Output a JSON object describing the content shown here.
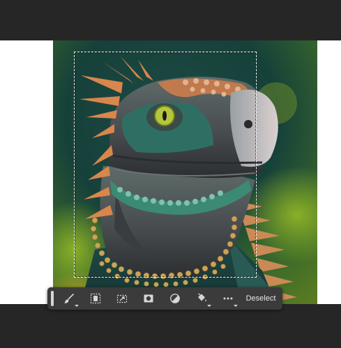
{
  "colors": {
    "workspace_bg": "#262626",
    "canvas_bg": "#ffffff",
    "toolbar_bg": "#3b3b3b",
    "icon_color": "#d6d6d6"
  },
  "image": {
    "subject": "iguana-portrait",
    "selection": "dashed-rectangle-marquee"
  },
  "toolbar": {
    "tools": [
      {
        "name": "brush-tool",
        "icon": "brush-icon",
        "has_dropdown": true
      },
      {
        "name": "select-subject",
        "icon": "select-subject-icon",
        "has_dropdown": false
      },
      {
        "name": "transform-selection",
        "icon": "transform-selection-icon",
        "has_dropdown": false
      },
      {
        "name": "add-mask",
        "icon": "mask-icon",
        "has_dropdown": false
      },
      {
        "name": "adjustment",
        "icon": "half-circle-icon",
        "has_dropdown": false
      },
      {
        "name": "fill",
        "icon": "paint-bucket-icon",
        "has_dropdown": true
      },
      {
        "name": "more-options",
        "icon": "ellipsis-icon",
        "has_dropdown": true
      }
    ],
    "deselect_label": "Deselect"
  }
}
